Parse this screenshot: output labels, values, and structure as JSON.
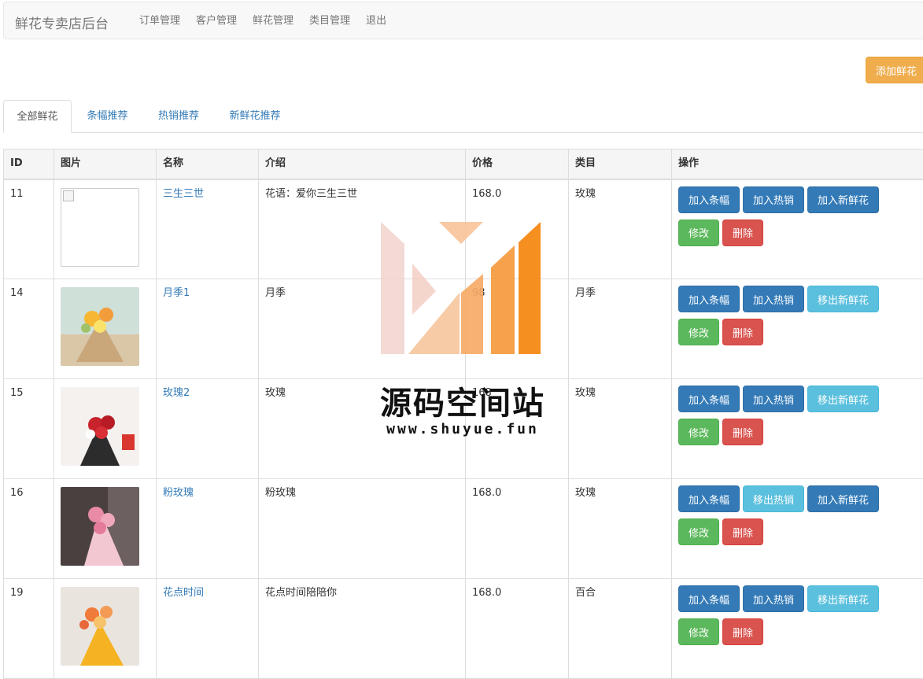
{
  "navbar": {
    "brand": "鲜花专卖店后台",
    "links": [
      "订单管理",
      "客户管理",
      "鲜花管理",
      "类目管理",
      "退出"
    ]
  },
  "toolbar": {
    "add_label": "添加鲜花"
  },
  "tabs": [
    {
      "label": "全部鲜花",
      "active": true
    },
    {
      "label": "条幅推荐",
      "active": false
    },
    {
      "label": "热销推荐",
      "active": false
    },
    {
      "label": "新鲜花推荐",
      "active": false
    }
  ],
  "table": {
    "headers": [
      "ID",
      "图片",
      "名称",
      "介绍",
      "价格",
      "类目",
      "操作"
    ],
    "rows": [
      {
        "id": "11",
        "image": "broken",
        "name": "三生三世",
        "intro": "花语：爱你三生三世",
        "price": "168.0",
        "category": "玫瑰",
        "banner_label": "加入条幅",
        "hot_label": "加入热销",
        "new_label": "加入新鲜花",
        "hot_active": false,
        "new_active": false
      },
      {
        "id": "14",
        "image": "bouquet-yellow",
        "name": "月季1",
        "intro": "月季",
        "price": "98",
        "category": "月季",
        "banner_label": "加入条幅",
        "hot_label": "加入热销",
        "new_label": "移出新鲜花",
        "hot_active": false,
        "new_active": true
      },
      {
        "id": "15",
        "image": "bouquet-red",
        "name": "玫瑰2",
        "intro": "玫瑰",
        "price": "168",
        "category": "玫瑰",
        "banner_label": "加入条幅",
        "hot_label": "加入热销",
        "new_label": "移出新鲜花",
        "hot_active": false,
        "new_active": true
      },
      {
        "id": "16",
        "image": "bouquet-pink",
        "name": "粉玫瑰",
        "intro": "粉玫瑰",
        "price": "168.0",
        "category": "玫瑰",
        "banner_label": "加入条幅",
        "hot_label": "移出热销",
        "new_label": "加入新鲜花",
        "hot_active": true,
        "new_active": false
      },
      {
        "id": "19",
        "image": "bouquet-orange",
        "name": "花点时间",
        "intro": "花点时间陪陪你",
        "price": "168.0",
        "category": "百合",
        "banner_label": "加入条幅",
        "hot_label": "加入热销",
        "new_label": "移出新鲜花",
        "hot_active": false,
        "new_active": true
      }
    ],
    "edit_label": "修改",
    "delete_label": "删除"
  },
  "watermark": {
    "title": "源码空间站",
    "url": "www.shuyue.fun"
  },
  "colors": {
    "primary": "#337ab7",
    "info": "#5bc0de",
    "success": "#5cb85c",
    "danger": "#d9534f",
    "warning": "#f0ad4e"
  }
}
